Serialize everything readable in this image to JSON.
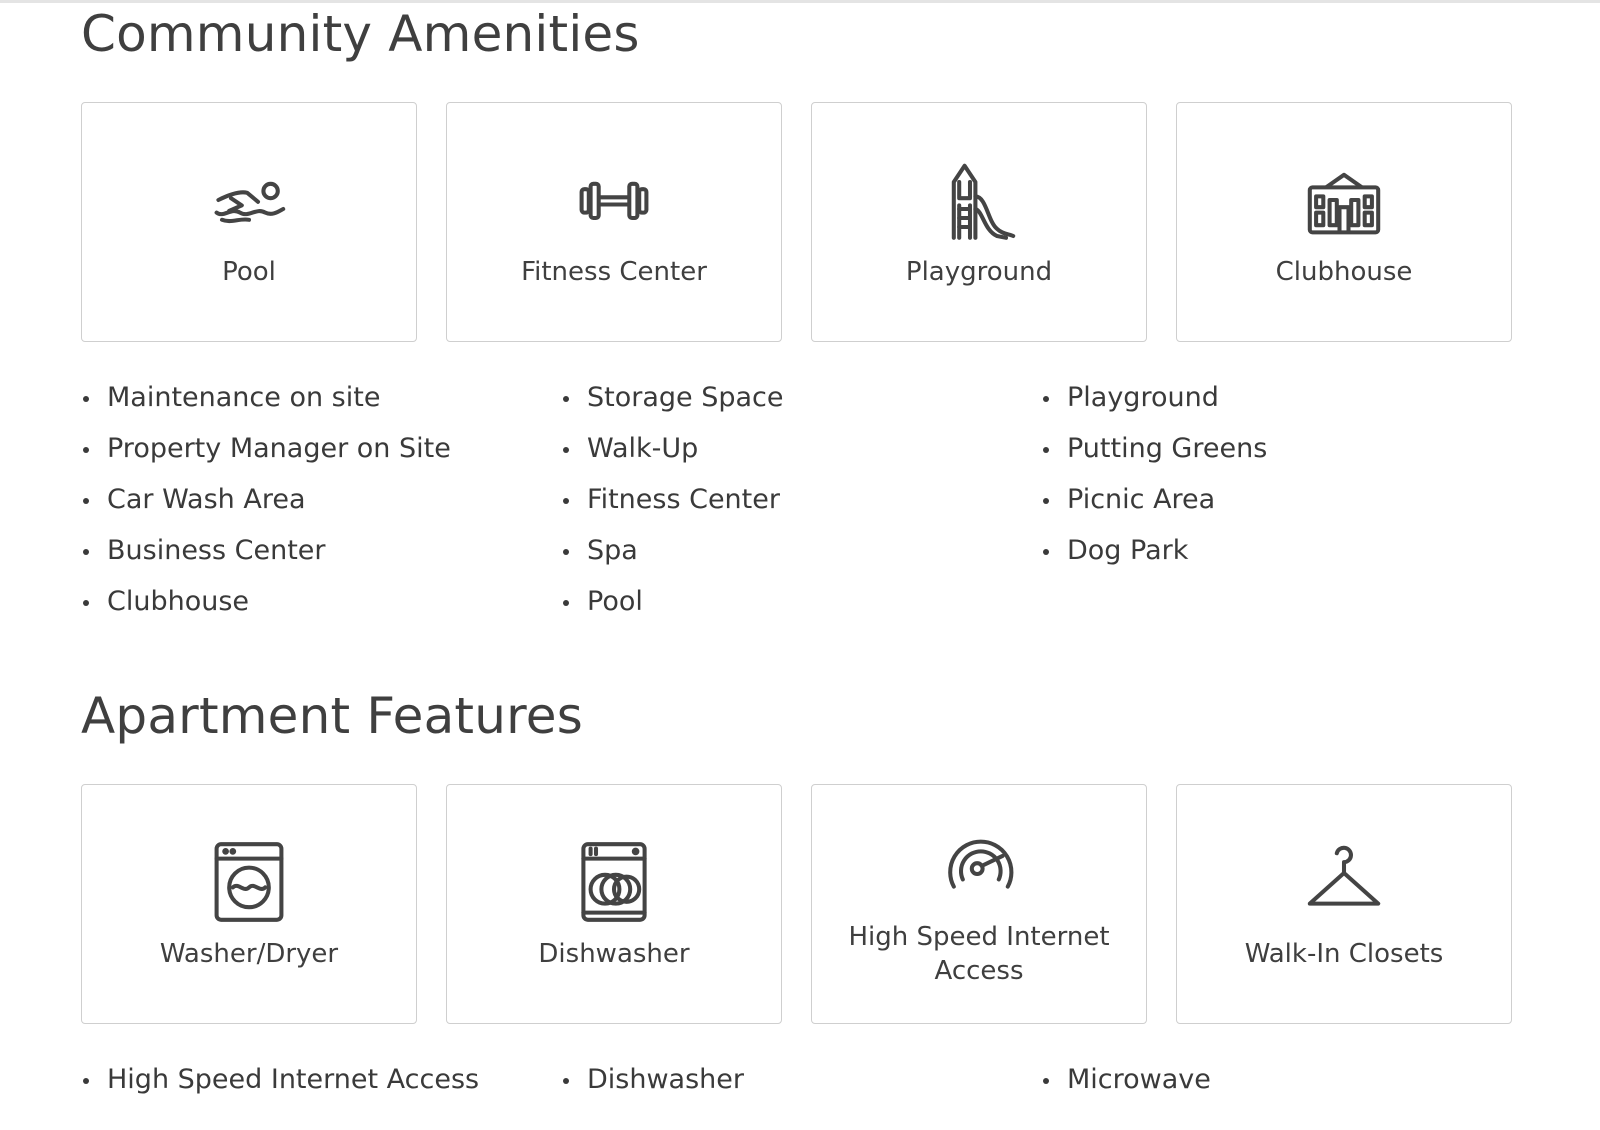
{
  "community": {
    "title": "Community Amenities",
    "cards": [
      {
        "label": "Pool",
        "icon": "swimmer-icon"
      },
      {
        "label": "Fitness Center",
        "icon": "dumbbell-icon"
      },
      {
        "label": "Playground",
        "icon": "slide-icon"
      },
      {
        "label": "Clubhouse",
        "icon": "clubhouse-icon"
      }
    ],
    "lists": [
      [
        "Maintenance on site",
        "Property Manager on Site",
        "Car Wash Area",
        "Business Center",
        "Clubhouse"
      ],
      [
        "Storage Space",
        "Walk-Up",
        "Fitness Center",
        "Spa",
        "Pool"
      ],
      [
        "Playground",
        "Putting Greens",
        "Picnic Area",
        "Dog Park"
      ]
    ]
  },
  "apartment": {
    "title": "Apartment Features",
    "cards": [
      {
        "label": "Washer/Dryer",
        "icon": "washer-icon"
      },
      {
        "label": "Dishwasher",
        "icon": "dishwasher-icon"
      },
      {
        "label": "High Speed Internet Access",
        "icon": "speedometer-icon"
      },
      {
        "label": "Walk-In Closets",
        "icon": "hanger-icon"
      }
    ],
    "lists": [
      [
        "High Speed Internet Access"
      ],
      [
        "Dishwasher"
      ],
      [
        "Microwave"
      ]
    ]
  },
  "colors": {
    "text": "#3f3f3f",
    "card_border": "#cfcfcf",
    "background": "#ffffff"
  }
}
